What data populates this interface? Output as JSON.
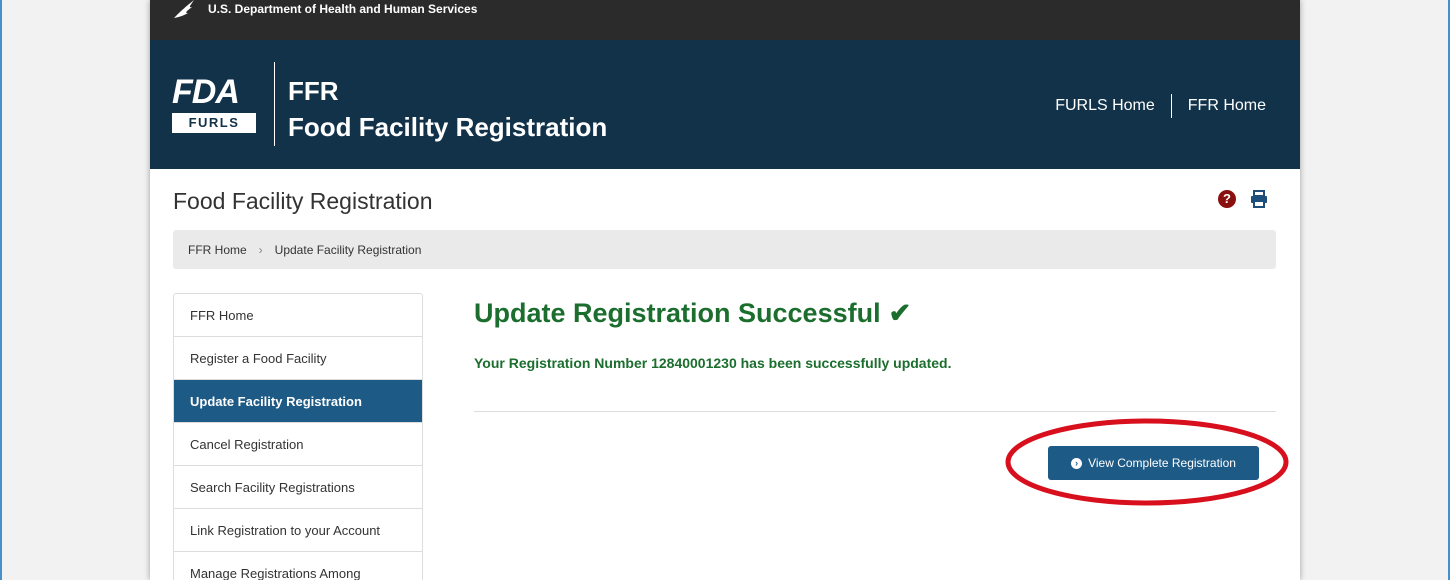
{
  "hhs_bar": {
    "agency_text": "U.S. Department of Health and Human Services"
  },
  "header": {
    "logo_fda": "FDA",
    "logo_furls": "FURLS",
    "app_abbr": "FFR",
    "app_name": "Food Facility Registration",
    "links": [
      "FURLS Home",
      "FFR Home"
    ]
  },
  "page": {
    "title": "Food Facility Registration"
  },
  "breadcrumb": [
    "FFR Home",
    "Update Facility Registration"
  ],
  "sidenav": {
    "items": [
      {
        "label": "FFR Home",
        "active": false
      },
      {
        "label": "Register a Food Facility",
        "active": false
      },
      {
        "label": "Update Facility Registration",
        "active": true
      },
      {
        "label": "Cancel Registration",
        "active": false
      },
      {
        "label": "Search Facility Registrations",
        "active": false
      },
      {
        "label": "Link Registration to your Account",
        "active": false
      },
      {
        "label": "Manage Registrations Among",
        "active": false
      }
    ]
  },
  "main": {
    "success_title": "Update Registration Successful",
    "success_check": "✔",
    "success_message": "Your Registration Number 12840001230  has been successfully updated.",
    "view_button_label": "View Complete Registration"
  },
  "colors": {
    "header_bg": "#12324a",
    "hhs_bar_bg": "#2b2b2b",
    "success_green": "#1b6e2d",
    "active_nav": "#1d5a86",
    "annotation_red": "#d8101e"
  },
  "icons": {
    "help": "question-circle-icon",
    "print": "printer-icon",
    "check": "check-icon",
    "button": "chevron-circle-right-icon",
    "hhs": "hhs-eagle-icon"
  }
}
